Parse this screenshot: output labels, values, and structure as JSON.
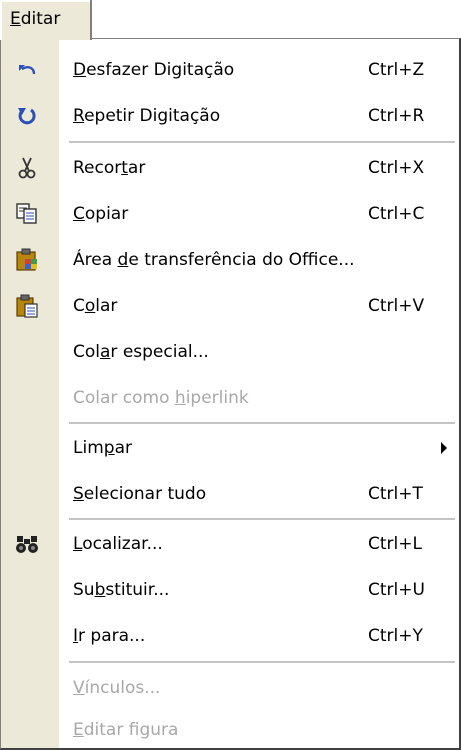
{
  "menubar": {
    "title_pre": "",
    "title_ul": "E",
    "title_post": "ditar"
  },
  "items": [
    {
      "pre": "",
      "ul": "D",
      "post": "esfazer Digitação",
      "shortcut": "Ctrl+Z",
      "icon": "undo-icon"
    },
    {
      "pre": "",
      "ul": "R",
      "post": "epetir Digitação",
      "shortcut": "Ctrl+R",
      "icon": "redo-icon"
    },
    {
      "pre": "Recor",
      "ul": "t",
      "post": "ar",
      "shortcut": "Ctrl+X",
      "icon": "scissors-icon"
    },
    {
      "pre": "",
      "ul": "C",
      "post": "opiar",
      "shortcut": "Ctrl+C",
      "icon": "copy-icon"
    },
    {
      "pre": "Área ",
      "ul": "d",
      "post": "e transferência do Office...",
      "shortcut": "",
      "icon": "office-clipboard-icon"
    },
    {
      "pre": "C",
      "ul": "o",
      "post": "lar",
      "shortcut": "Ctrl+V",
      "icon": "paste-icon"
    },
    {
      "pre": "Col",
      "ul": "a",
      "post": "r especial...",
      "shortcut": ""
    },
    {
      "pre": "Colar como ",
      "ul": "h",
      "post": "iperlink",
      "shortcut": "",
      "disabled": true
    },
    {
      "pre": "Lim",
      "ul": "p",
      "post": "ar",
      "shortcut": "",
      "submenu": true
    },
    {
      "pre": "",
      "ul": "S",
      "post": "elecionar tudo",
      "shortcut": "Ctrl+T"
    },
    {
      "pre": "",
      "ul": "L",
      "post": "ocalizar...",
      "shortcut": "Ctrl+L",
      "icon": "binoculars-icon"
    },
    {
      "pre": "Su",
      "ul": "b",
      "post": "stituir...",
      "shortcut": "Ctrl+U"
    },
    {
      "pre": "",
      "ul": "I",
      "post": "r para...",
      "shortcut": "Ctrl+Y"
    },
    {
      "pre": "",
      "ul": "V",
      "post": "ínculos...",
      "shortcut": "",
      "disabled": true
    },
    {
      "pre": "",
      "ul": "E",
      "post": "ditar figura",
      "shortcut": "",
      "disabled": true
    }
  ],
  "colors": {
    "icon_strip": "#ece9d8",
    "disabled_text": "#a8a8a8",
    "separator": "#c4c4c4"
  }
}
